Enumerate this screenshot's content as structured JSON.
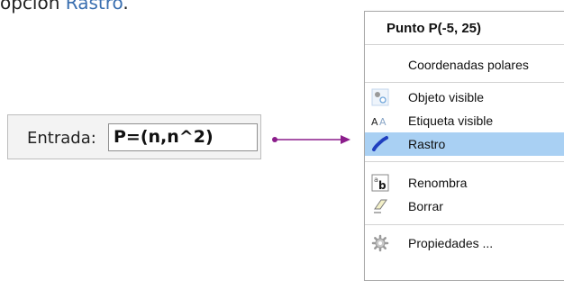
{
  "caption": {
    "text": "opción ",
    "highlight": "Rastro",
    "end": "."
  },
  "input_bar": {
    "label": "Entrada:",
    "value": "P=(n,n^2)"
  },
  "context_menu": {
    "title": "Punto P(-5, 25)",
    "items": [
      {
        "label": "Coordenadas polares",
        "icon": ""
      },
      {
        "label": "Objeto visible",
        "icon": "object-visible-icon"
      },
      {
        "label": "Etiqueta visible",
        "icon": "label-visible-icon"
      },
      {
        "label": "Rastro",
        "icon": "trace-icon",
        "selected": true
      },
      {
        "label": "Renombra",
        "icon": "rename-icon"
      },
      {
        "label": "Borrar",
        "icon": "eraser-icon"
      },
      {
        "label": "Propiedades ...",
        "icon": "gear-icon"
      }
    ]
  },
  "colors": {
    "arrow": "#8b1d8b",
    "highlight_text": "#3a6fb0",
    "selected_row": "#a9d0f3"
  }
}
